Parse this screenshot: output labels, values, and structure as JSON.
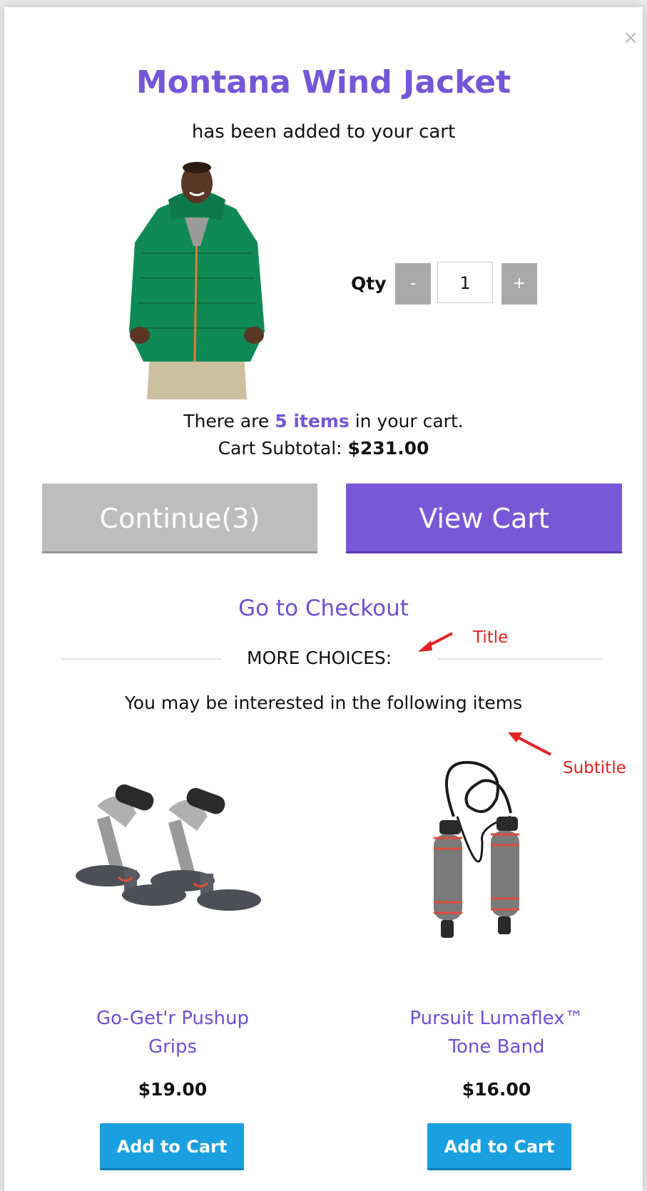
{
  "modal": {
    "close_symbol": "×",
    "product_title": "Montana Wind Jacket",
    "added_text": "has been added to your cart",
    "qty_label": "Qty",
    "qty_minus": "-",
    "qty_value": "1",
    "qty_plus": "+",
    "cart_line_prefix": "There are ",
    "cart_items": "5 items",
    "cart_line_suffix": " in your cart.",
    "subtotal_label": "Cart Subtotal: ",
    "subtotal_value": "$231.00",
    "continue_label": "Continue(3)",
    "view_cart_label": "View Cart",
    "checkout_label": "Go to Checkout",
    "more_title": "MORE CHOICES:",
    "more_subtitle": "You may be interested in the following items"
  },
  "annotations": {
    "title": "Title",
    "subtitle": "Subtitle"
  },
  "recommendations": [
    {
      "name_line1": "Go-Get'r Pushup",
      "name_line2": "Grips",
      "price": "$19.00",
      "button": "Add to Cart"
    },
    {
      "name_line1": "Pursuit Lumaflex™",
      "name_line2": "Tone Band",
      "price": "$16.00",
      "button": "Add to Cart"
    }
  ],
  "colors": {
    "accent": "#7457d6",
    "view_cart_bg": "#7a57d6",
    "continue_bg": "#bdbdbd",
    "add_to_cart_bg": "#1a9fe0",
    "annotation": "#e32222"
  },
  "icons": {
    "close": "close-icon",
    "title_arrow": "arrow-icon",
    "subtitle_arrow": "arrow-icon"
  }
}
